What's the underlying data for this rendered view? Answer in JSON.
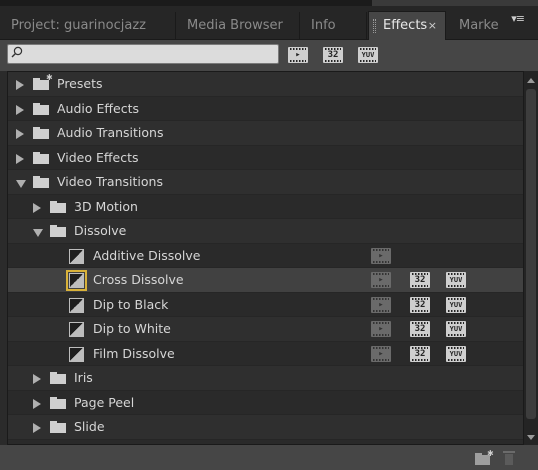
{
  "tabs": [
    {
      "label": "Project: guarinocjazz",
      "active": false
    },
    {
      "label": "Media Browser",
      "active": false
    },
    {
      "label": "Info",
      "active": false
    },
    {
      "label": "Effects",
      "active": true
    },
    {
      "label": "Marke",
      "active": false
    }
  ],
  "tab_close_glyph": "×",
  "panel_menu_glyph": "▾≡",
  "search": {
    "value": "",
    "placeholder": ""
  },
  "filter_icons": [
    {
      "name": "accelerated-effects-icon",
      "label": ""
    },
    {
      "name": "32-bit-color-icon",
      "label": "32"
    },
    {
      "name": "yuv-effects-icon",
      "label": "YUV"
    }
  ],
  "tree": [
    {
      "label": "Presets",
      "level": 0,
      "kind": "folder",
      "state": "collapsed",
      "special": true
    },
    {
      "label": "Audio Effects",
      "level": 0,
      "kind": "folder",
      "state": "collapsed"
    },
    {
      "label": "Audio Transitions",
      "level": 0,
      "kind": "folder",
      "state": "collapsed"
    },
    {
      "label": "Video Effects",
      "level": 0,
      "kind": "folder",
      "state": "collapsed"
    },
    {
      "label": "Video Transitions",
      "level": 0,
      "kind": "folder",
      "state": "expanded"
    },
    {
      "label": "3D Motion",
      "level": 1,
      "kind": "folder",
      "state": "collapsed"
    },
    {
      "label": "Dissolve",
      "level": 1,
      "kind": "folder",
      "state": "expanded"
    },
    {
      "label": "Additive Dissolve",
      "level": 2,
      "kind": "transition",
      "flags": {
        "accel": true,
        "bit32": false,
        "yuv": false
      }
    },
    {
      "label": "Cross Dissolve",
      "level": 2,
      "kind": "transition",
      "selected": true,
      "flags": {
        "accel": true,
        "bit32": true,
        "yuv": true
      }
    },
    {
      "label": "Dip to Black",
      "level": 2,
      "kind": "transition",
      "flags": {
        "accel": true,
        "bit32": true,
        "yuv": true
      }
    },
    {
      "label": "Dip to White",
      "level": 2,
      "kind": "transition",
      "flags": {
        "accel": true,
        "bit32": true,
        "yuv": true
      }
    },
    {
      "label": "Film Dissolve",
      "level": 2,
      "kind": "transition",
      "flags": {
        "accel": true,
        "bit32": true,
        "yuv": true
      }
    },
    {
      "label": "Iris",
      "level": 1,
      "kind": "folder",
      "state": "collapsed"
    },
    {
      "label": "Page Peel",
      "level": 1,
      "kind": "folder",
      "state": "collapsed"
    },
    {
      "label": "Slide",
      "level": 1,
      "kind": "folder",
      "state": "collapsed"
    }
  ],
  "colors": {
    "panel_bg": "#2b2b2b",
    "active_tab_bg": "#464646",
    "selected_row": "#414141",
    "selection_outline": "#d9b23a",
    "text": "#d6d6d6"
  }
}
